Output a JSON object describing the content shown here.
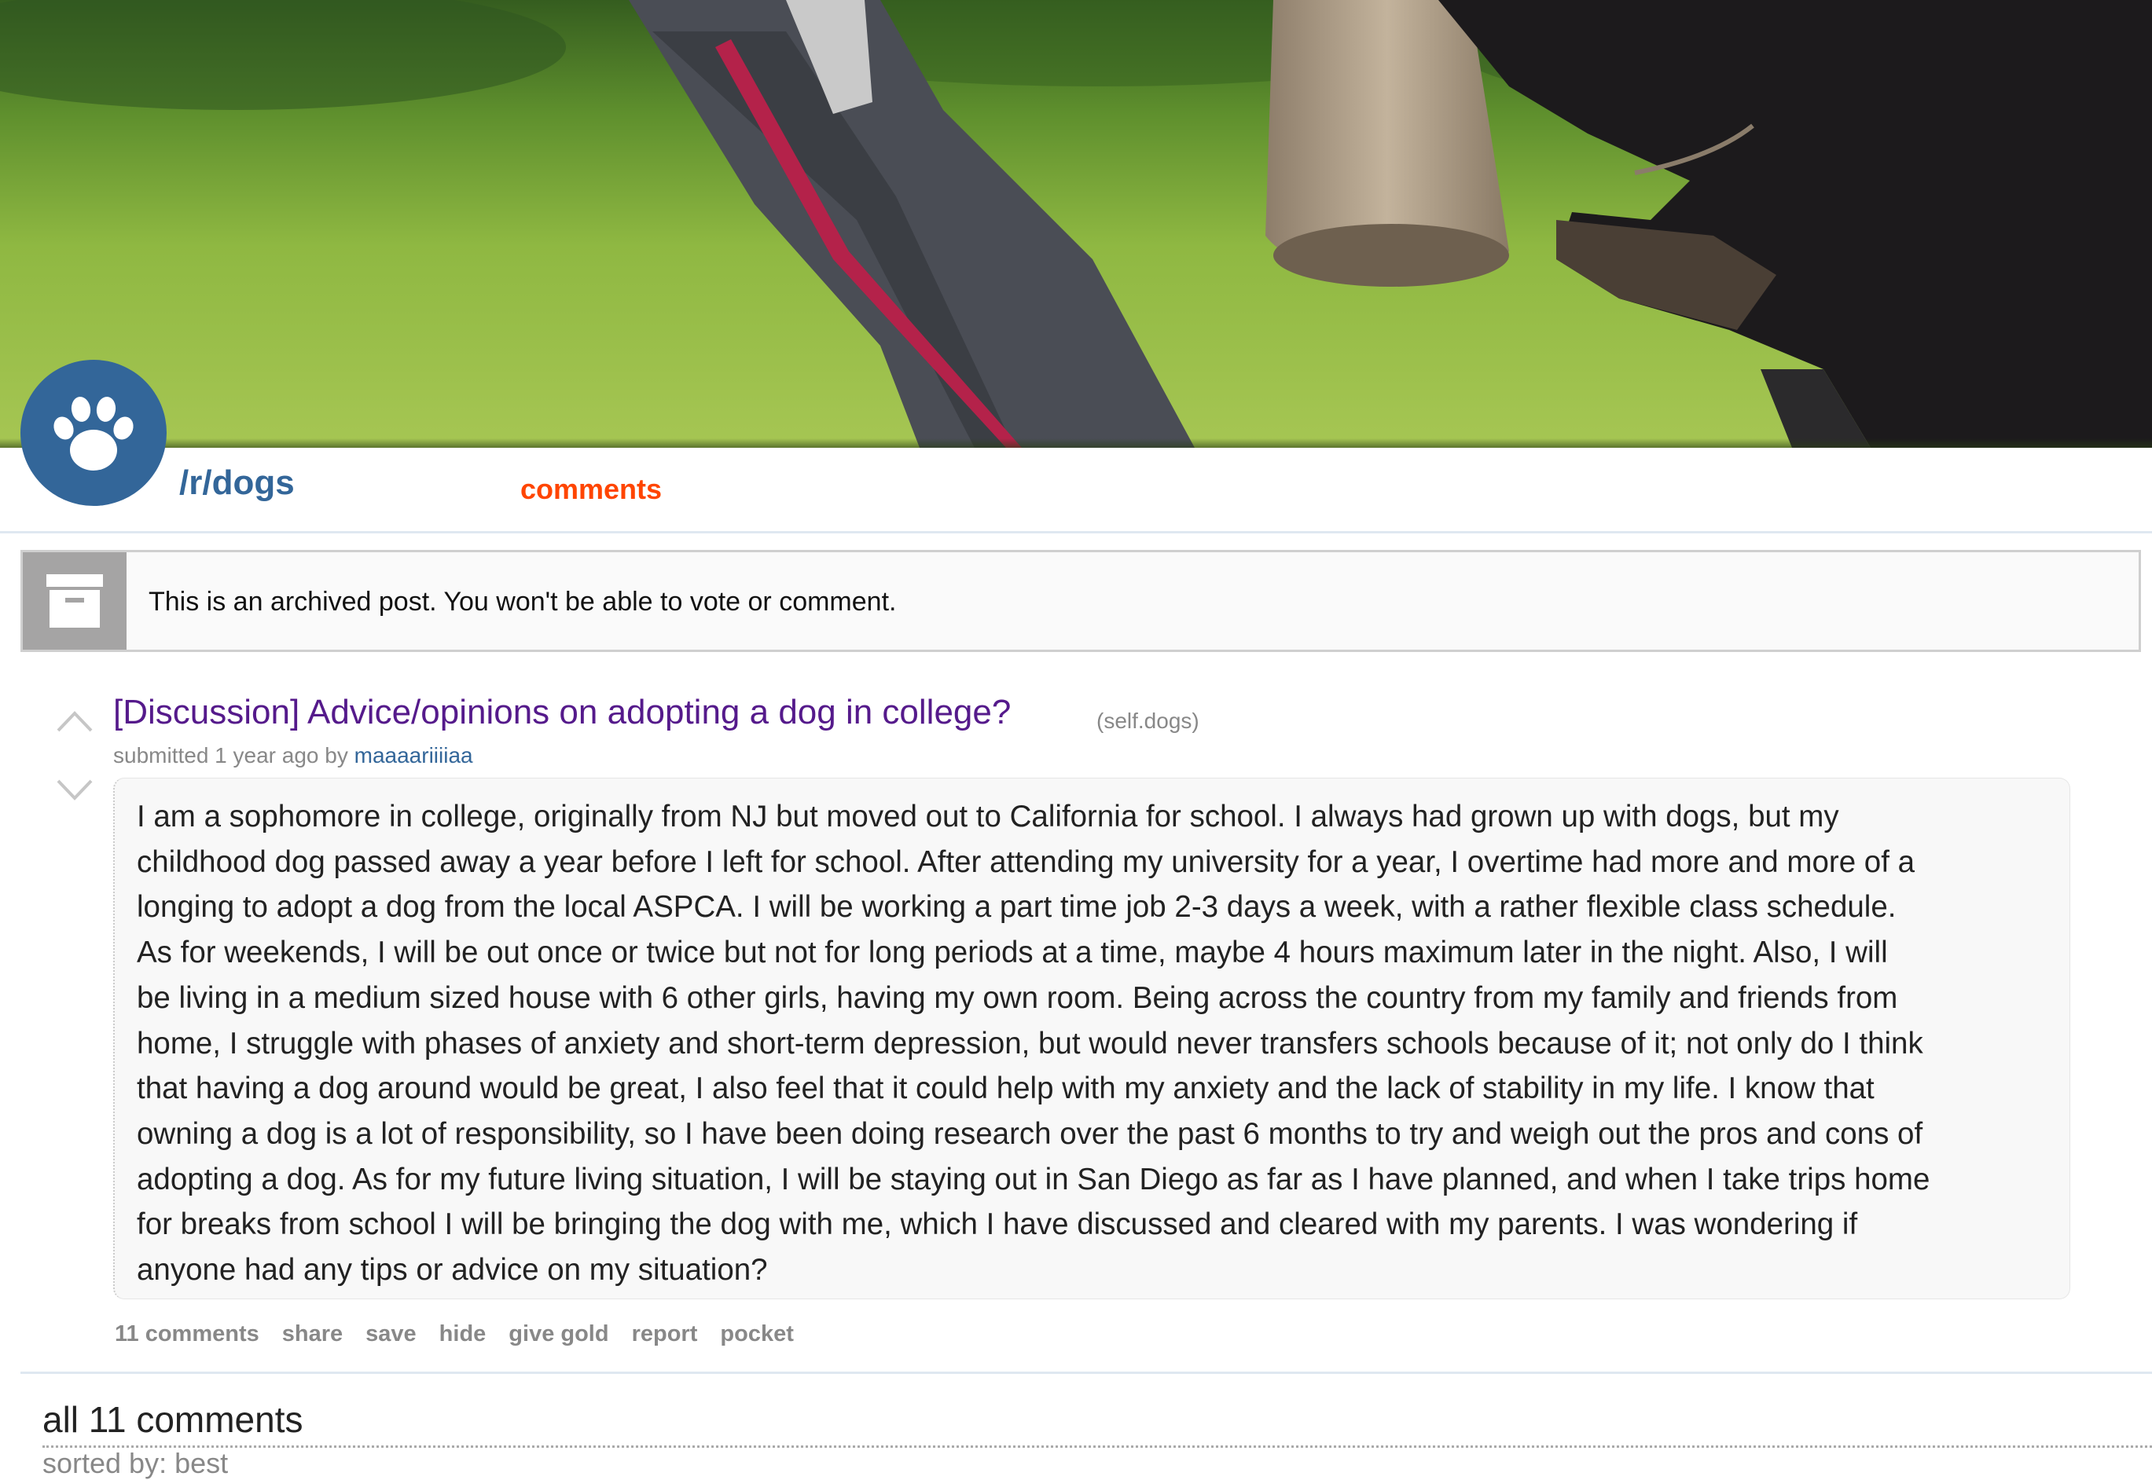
{
  "header": {
    "subreddit": "/r/dogs",
    "tab_label": "comments"
  },
  "archived_notice": {
    "text": "This is an archived post. You won't be able to vote or comment."
  },
  "post": {
    "title": "[Discussion] Advice/opinions on adopting a dog in college?",
    "domain": "(self.dogs)",
    "submitted_prefix": "submitted 1 year ago by",
    "author": "maaaariiiiaa",
    "body_lines": [
      "I am a sophomore in college, originally from NJ but moved out to California for school. I always had grown up with dogs, but my",
      "childhood dog passed away a year before I left for school. After attending my university for a year, I overtime had more and more of a",
      "longing to adopt a dog from the local ASPCA. I will be working a part time job 2-3 days a week, with a rather flexible class schedule.",
      "As for weekends, I will be out once or twice but not for long periods at a time, maybe 4 hours maximum later in the night. Also, I will",
      "be living in a medium sized house with 6 other girls, having my own room. Being across the country from my family and friends from",
      "home, I struggle with phases of anxiety and short-term depression, but would never transfers schools because of it; not only do I think",
      "that having a dog around would be great, I also feel that it could help with my anxiety and the lack of stability in my life. I know that",
      "owning a dog is a lot of responsibility, so I have been doing research over the past 6 months to try and weigh out the pros and cons of",
      "adopting a dog. As for my future living situation, I will be staying out in San Diego as far as I have planned, and when I take trips home",
      "for breaks from school I will be bringing the dog with me, which I have discussed and cleared with my parents. I was wondering if",
      "anyone had any tips or advice on my situation?"
    ],
    "buttons": {
      "comments": "11 comments",
      "share": "share",
      "save": "save",
      "hide": "hide",
      "give_gold": "give gold",
      "report": "report",
      "pocket": "pocket"
    }
  },
  "comments_area": {
    "heading": "all 11 comments",
    "sort_label": "sorted by: best"
  },
  "colors": {
    "subreddit_blue": "#336699",
    "active_tab": "#ff4500",
    "visited_title": "#551a8b",
    "muted": "#888888"
  },
  "icons": [
    "paw-icon",
    "archive-icon",
    "upvote-arrow-icon",
    "downvote-arrow-icon"
  ]
}
